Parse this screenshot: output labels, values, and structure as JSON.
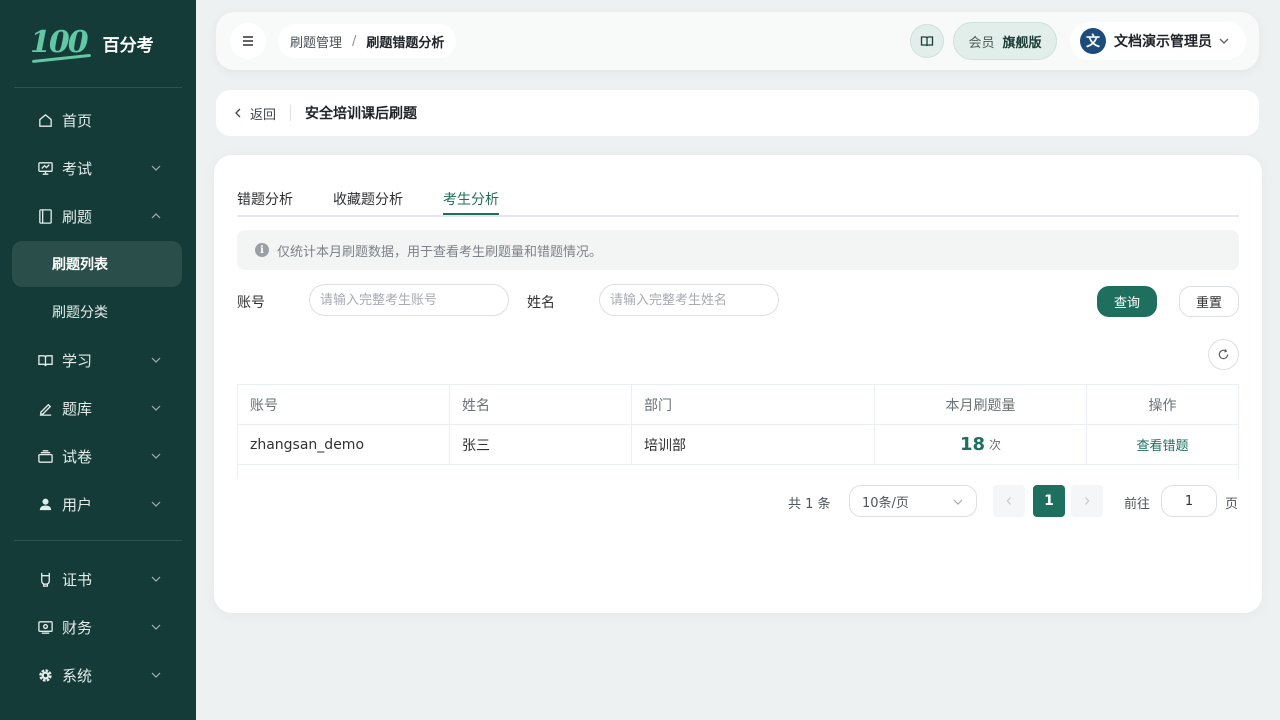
{
  "app": {
    "logo_mark": "100",
    "name": "百分考"
  },
  "sidebar": {
    "items": [
      {
        "label": "首页",
        "icon": "home-icon"
      },
      {
        "label": "考试",
        "icon": "exam-board-icon"
      },
      {
        "label": "刷题",
        "icon": "notebook-icon",
        "expanded": true
      },
      {
        "label": "学习",
        "icon": "open-book-icon"
      },
      {
        "label": "题库",
        "icon": "pen-icon"
      },
      {
        "label": "试卷",
        "icon": "paper-stack-icon"
      },
      {
        "label": "用户",
        "icon": "user-icon"
      },
      {
        "label": "证书",
        "icon": "certificate-icon"
      },
      {
        "label": "财务",
        "icon": "wallet-icon"
      },
      {
        "label": "系统",
        "icon": "gear-icon"
      }
    ],
    "sub_items": [
      {
        "label": "刷题列表",
        "active": true
      },
      {
        "label": "刷题分类",
        "active": false
      }
    ]
  },
  "header": {
    "breadcrumb": [
      "刷题管理",
      "刷题错题分析"
    ],
    "breadcrumb_sep": "/",
    "member_label": "会员",
    "member_level": "旗舰版",
    "avatar_text": "文",
    "user_name": "文档演示管理员"
  },
  "backbar": {
    "back_label": "返回",
    "title": "安全培训课后刷题"
  },
  "tabs": [
    {
      "label": "错题分析",
      "active": false
    },
    {
      "label": "收藏题分析",
      "active": false
    },
    {
      "label": "考生分析",
      "active": true
    }
  ],
  "notice": {
    "icon_text": "i",
    "text": "仅统计本月刷题数据，用于查看考生刷题量和错题情况。"
  },
  "filters": {
    "account_label": "账号",
    "account_placeholder": "请输入完整考生账号",
    "name_label": "姓名",
    "name_placeholder": "请输入完整考生姓名",
    "query_label": "查询",
    "reset_label": "重置"
  },
  "table": {
    "columns": [
      "账号",
      "姓名",
      "部门",
      "本月刷题量",
      "操作"
    ],
    "rows": [
      {
        "account": "zhangsan_demo",
        "name": "张三",
        "department": "培训部",
        "count": "18",
        "count_unit": "次",
        "action": "查看错题"
      }
    ]
  },
  "pagination": {
    "total_text": "共 1 条",
    "page_size": "10条/页",
    "current_page": "1",
    "goto_label": "前往",
    "goto_value": "1",
    "goto_suffix": "页"
  },
  "colors": {
    "sidebar_bg": "#143b37",
    "accent": "#1f6f5e",
    "logo": "#62c7a5"
  }
}
